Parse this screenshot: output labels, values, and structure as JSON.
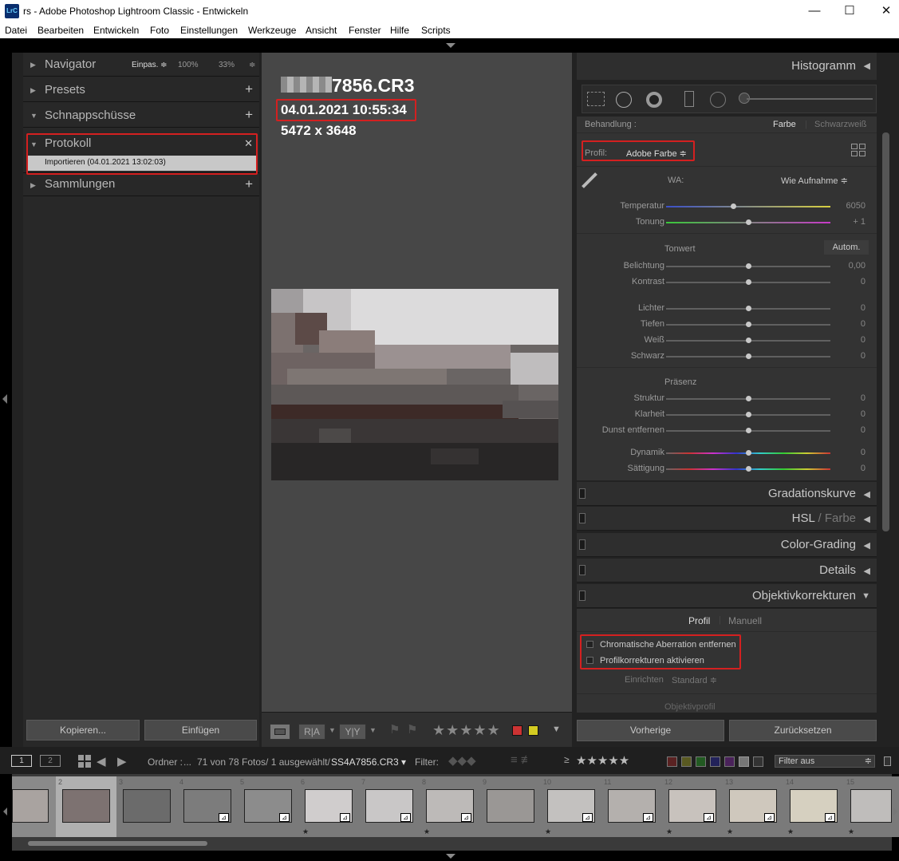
{
  "window": {
    "app_icon": "LrC",
    "title": "rs - Adobe Photoshop Lightroom Classic - Entwickeln",
    "min": "—",
    "max": "☐",
    "close": "✕"
  },
  "menu": [
    "Datei",
    "Bearbeiten",
    "Entwickeln",
    "Foto",
    "Einstellungen",
    "Werkzeuge",
    "Ansicht",
    "Fenster",
    "Hilfe",
    "Scripts"
  ],
  "left": {
    "navigator": {
      "title": "Navigator",
      "fit": "Einpas. ≑",
      "zoom1": "100%",
      "zoom2": "33%"
    },
    "presets": {
      "title": "Presets"
    },
    "snapshots": {
      "title": "Schnappschüsse"
    },
    "history": {
      "title": "Protokoll",
      "close": "✕",
      "item": "Importieren (04.01.2021 13:02:03)"
    },
    "collections": {
      "title": "Sammlungen"
    },
    "copy_label": "Kopieren...",
    "paste_label": "Einfügen"
  },
  "info": {
    "filename": "7856.CR3",
    "datetime": "04.01.2021 10:55:34",
    "dimensions": "5472 x 3648"
  },
  "toolbar": {
    "compare": "R|A",
    "ya": "Y|Y",
    "stars": "★★★★★"
  },
  "right": {
    "histogram": "Histogramm",
    "behandlung": {
      "label": "Behandlung :",
      "color": "Farbe",
      "bw": "Schwarzweiß"
    },
    "profile": {
      "label": "Profil:",
      "value": "Adobe Farbe ≑"
    },
    "wb": {
      "label": "WA:",
      "value": "Wie Aufnahme ≑"
    },
    "temp": {
      "label": "Temperatur",
      "value": "6050"
    },
    "tint": {
      "label": "Tonung",
      "value": "+ 1"
    },
    "tonwert": "Tonwert",
    "auto": "Autom.",
    "sliders": [
      {
        "label": "Belichtung",
        "value": "0,00"
      },
      {
        "label": "Kontrast",
        "value": "0"
      },
      {
        "label": "Lichter",
        "value": "0"
      },
      {
        "label": "Tiefen",
        "value": "0"
      },
      {
        "label": "Weiß",
        "value": "0"
      },
      {
        "label": "Schwarz",
        "value": "0"
      },
      {
        "label": "Struktur",
        "value": "0"
      },
      {
        "label": "Klarheit",
        "value": "0"
      },
      {
        "label": "Dunst entfernen",
        "value": "0"
      },
      {
        "label": "Dynamik",
        "value": "0"
      },
      {
        "label": "Sättigung",
        "value": "0"
      }
    ],
    "praesenz": "Präsenz",
    "panels": [
      "Gradationskurve",
      "HSL",
      "Color-Grading",
      "Details",
      "Objektivkorrekturen"
    ],
    "hsl_sep": "/",
    "hsl_color": "Farbe",
    "lens": {
      "tab1": "Profil",
      "tab2": "Manuell",
      "cb1": "Chromatische Aberration entfernen",
      "cb2": "Profilkorrekturen aktivieren",
      "setup_label": "Einrichten",
      "setup_value": "Standard ≑",
      "profil_title": "Objektivprofil"
    },
    "prev_label": "Vorherige",
    "reset_label": "Zurücksetzen"
  },
  "filmstrip": {
    "folder_label": "Ordner :",
    "folder_dots": "...",
    "count": "71 von 78 Fotos/ 1 ausgewählt/",
    "file": "SS4A7856.CR3 ▾",
    "filter_label": "Filter:",
    "gte": "≥",
    "stars": "★★★★★",
    "filter_value": "Filter aus",
    "page1": "1",
    "page2": "2",
    "cells": [
      {
        "num": ""
      },
      {
        "num": "2"
      },
      {
        "num": "3"
      },
      {
        "num": "4"
      },
      {
        "num": "5"
      },
      {
        "num": "6"
      },
      {
        "num": "7"
      },
      {
        "num": "8"
      },
      {
        "num": "9"
      },
      {
        "num": "10"
      },
      {
        "num": "11"
      },
      {
        "num": "12"
      },
      {
        "num": "13"
      },
      {
        "num": "14"
      },
      {
        "num": "15"
      }
    ]
  }
}
